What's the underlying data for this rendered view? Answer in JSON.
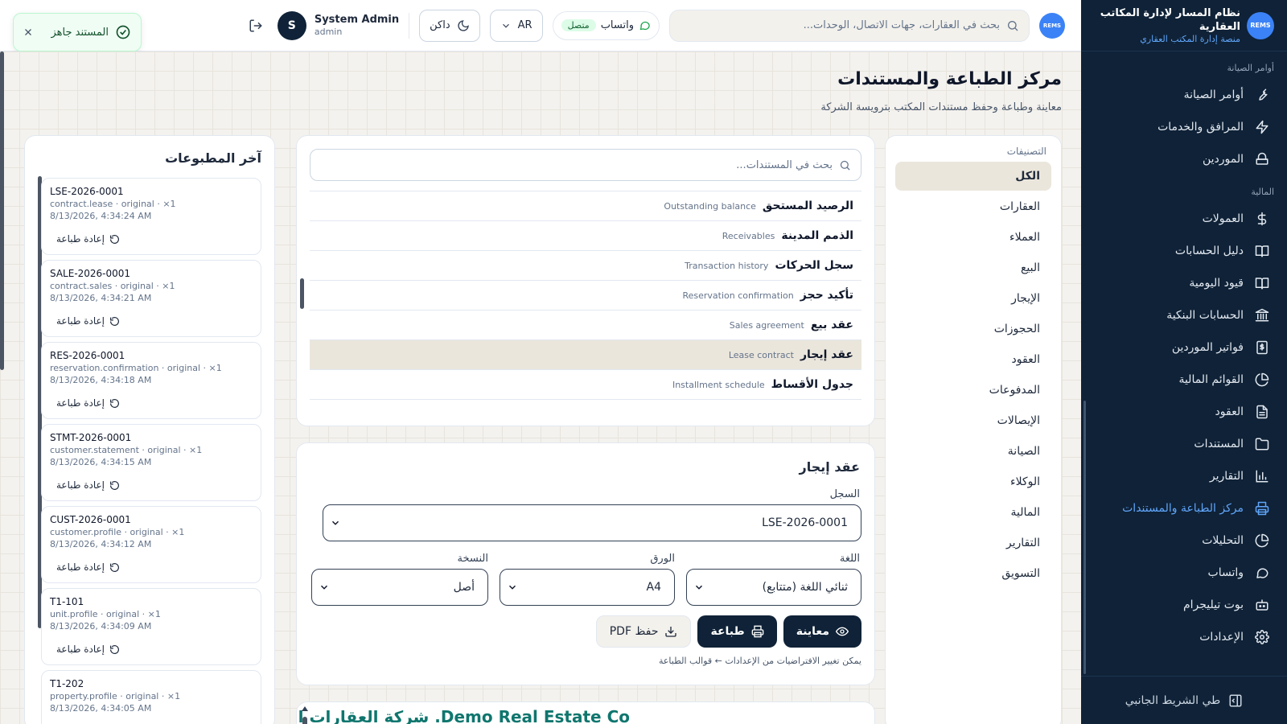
{
  "brand": {
    "logo_text": "REMS",
    "title": "نظام المسار لإدارة المكاتب العقارية",
    "subtitle": "منصة إدارة المكتب العقاري"
  },
  "sidebar": {
    "sections": [
      {
        "title": "أوامر الصيانة",
        "items": [
          {
            "label": "أوامر الصيانة",
            "icon": "wrench-icon"
          },
          {
            "label": "المرافق والخدمات",
            "icon": "bolt-icon"
          },
          {
            "label": "الموردين",
            "icon": "supplier-icon"
          }
        ]
      },
      {
        "title": "المالية",
        "items": [
          {
            "label": "العمولات",
            "icon": "dollar-icon"
          },
          {
            "label": "دليل الحسابات",
            "icon": "book-icon"
          },
          {
            "label": "قيود اليومية",
            "icon": "book-icon"
          },
          {
            "label": "الحسابات البنكية",
            "icon": "bank-icon"
          },
          {
            "label": "فواتير الموردين",
            "icon": "invoice-icon"
          },
          {
            "label": "القوائم المالية",
            "icon": "pie-icon"
          },
          {
            "label": "العقود",
            "icon": "document-icon"
          },
          {
            "label": "المستندات",
            "icon": "folder-icon"
          },
          {
            "label": "التقارير",
            "icon": "bar-chart-icon"
          },
          {
            "label": "مركز الطباعة والمستندات",
            "icon": "printer-icon",
            "active": true
          },
          {
            "label": "التحليلات",
            "icon": "pie-icon"
          },
          {
            "label": "واتساب",
            "icon": "chat-icon"
          },
          {
            "label": "بوت تيليجرام",
            "icon": "bot-icon"
          },
          {
            "label": "الإعدادات",
            "icon": "gear-icon"
          }
        ]
      }
    ],
    "collapse_label": "طي الشريط الجانبي"
  },
  "topbar": {
    "search_placeholder": "بحث في العقارات، جهات الاتصال، الوحدات...",
    "whatsapp_label": "واتساب",
    "whatsapp_status": "متصل",
    "language": "AR",
    "theme_label": "داكن",
    "user_name": "System Admin",
    "user_role": "admin",
    "user_initial": "S"
  },
  "toast": {
    "message": "المستند جاهز"
  },
  "page": {
    "title": "مركز الطباعة والمستندات",
    "subtitle": "معاينة وطباعة وحفظ مستندات المكتب بترويسة الشركة"
  },
  "categories": {
    "title": "التصنيفات",
    "items": [
      "الكل",
      "العقارات",
      "العملاء",
      "البيع",
      "الإيجار",
      "الحجوزات",
      "العقود",
      "المدفوعات",
      "الإيصالات",
      "الصيانة",
      "الوكلاء",
      "المالية",
      "التقارير",
      "التسويق"
    ],
    "active_index": 0
  },
  "documents": {
    "search_placeholder": "بحث في المستندات...",
    "items": [
      {
        "ar": "الرصيد المستحق",
        "en": "Outstanding balance"
      },
      {
        "ar": "الذمم المدينة",
        "en": "Receivables"
      },
      {
        "ar": "سجل الحركات",
        "en": "Transaction history"
      },
      {
        "ar": "تأكيد حجز",
        "en": "Reservation confirmation"
      },
      {
        "ar": "عقد بيع",
        "en": "Sales agreement"
      },
      {
        "ar": "عقد إيجار",
        "en": "Lease contract"
      },
      {
        "ar": "جدول الأقساط",
        "en": "Installment schedule"
      }
    ],
    "selected_index": 5
  },
  "form": {
    "title": "عقد إيجار",
    "record_label": "السجل",
    "record_value": "LSE-2026-0001",
    "language_label": "اللغة",
    "language_value": "ثنائي اللغة (متتابع)",
    "paper_label": "الورق",
    "paper_value": "A4",
    "copy_label": "النسخة",
    "copy_value": "أصل",
    "preview_button": "معاينة",
    "print_button": "طباعة",
    "pdf_button": "حفظ PDF",
    "hint": "يمكن تغيير الافتراضيات من الإعدادات ← قوالب الطباعة"
  },
  "preview": {
    "company_name": "Demo Real Estate Co. شركة العقارات التجريبية"
  },
  "recent": {
    "title": "آخر المطبوعات",
    "reprint_label": "إعادة طباعة",
    "items": [
      {
        "code": "LSE-2026-0001",
        "meta": "contract.lease · original · ×1",
        "time": "8/13/2026, 4:34:24 AM"
      },
      {
        "code": "SALE-2026-0001",
        "meta": "contract.sales · original · ×1",
        "time": "8/13/2026, 4:34:21 AM"
      },
      {
        "code": "RES-2026-0001",
        "meta": "reservation.confirmation · original · ×1",
        "time": "8/13/2026, 4:34:18 AM"
      },
      {
        "code": "STMT-2026-0001",
        "meta": "customer.statement · original · ×1",
        "time": "8/13/2026, 4:34:15 AM"
      },
      {
        "code": "CUST-2026-0001",
        "meta": "customer.profile · original · ×1",
        "time": "8/13/2026, 4:34:12 AM"
      },
      {
        "code": "T1-101",
        "meta": "unit.profile · original · ×1",
        "time": "8/13/2026, 4:34:09 AM"
      },
      {
        "code": "T1-202",
        "meta": "property.profile · original · ×1",
        "time": "8/13/2026, 4:34:05 AM"
      }
    ]
  },
  "colors": {
    "sidebar_bg": "#0f2237",
    "accent": "#60a5fa",
    "selected_row": "#ebe6dc",
    "primary_button": "#0f2237",
    "success": "#16a34a",
    "company_name": "#0f766e"
  }
}
